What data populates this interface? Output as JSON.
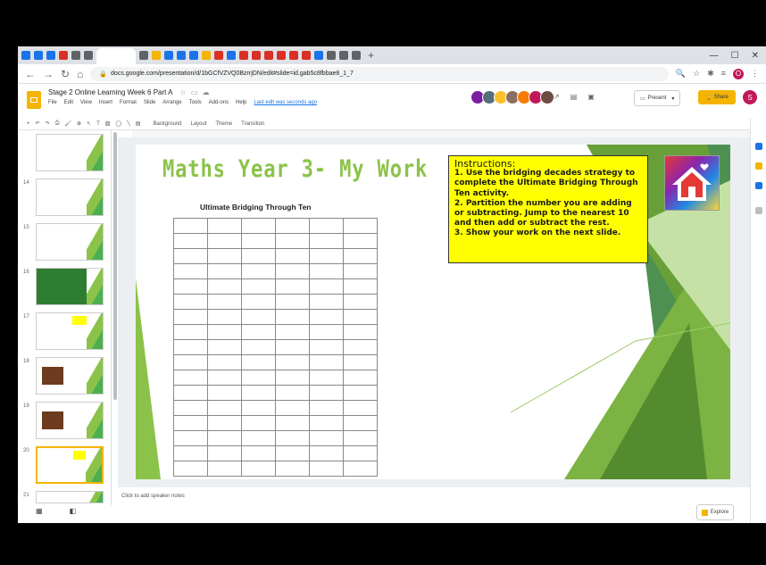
{
  "browser": {
    "url": "docs.google.com/presentation/d/1bGCfVZVQ0BzrrjDN/edit#slide=id.gab5c8fbbae8_1_7",
    "address_icons": [
      "search-icon",
      "star-icon",
      "extension-icon",
      "reading-list-icon",
      "profile-icon",
      "menu-icon"
    ],
    "profile_initial": "O",
    "tab_favicon_colors": [
      "#1a73e8",
      "#1a73e8",
      "#1a73e8",
      "#d93025",
      "#5f6368",
      "#5f6368",
      "#5f6368",
      "#f4b400",
      "#1a73e8",
      "#1a73e8",
      "#1a73e8",
      "#f4b400",
      "#d93025",
      "#1a73e8",
      "#d93025",
      "#d93025",
      "#d93025",
      "#d93025",
      "#d93025",
      "#d93025",
      "#1a73e8",
      "#5f6368",
      "#5f6368",
      "#5f6368"
    ]
  },
  "doc": {
    "title": "Stage 2 Online Learning Week 6 Part A",
    "menus": [
      "File",
      "Edit",
      "View",
      "Insert",
      "Format",
      "Slide",
      "Arrange",
      "Tools",
      "Add-ons",
      "Help"
    ],
    "last_edit": "Last edit was seconds ago",
    "present_label": "Present",
    "share_label": "Share",
    "user_initial": "S",
    "collaborator_colors": [
      "#7b1fa2",
      "#546e7a",
      "#fbc02d",
      "#8d6e63",
      "#f57c00",
      "#c2185b",
      "#6d4c41"
    ]
  },
  "toolbar": {
    "items": [
      "Background",
      "Layout",
      "Theme",
      "Transition"
    ]
  },
  "filmstrip": {
    "slide_numbers": [
      "",
      "14",
      "15",
      "16",
      "17",
      "18",
      "19",
      "20",
      "21"
    ],
    "selected_index": 7
  },
  "slide": {
    "title": "Maths Year 3- My Work",
    "sheet_title": "Ultimate Bridging Through Ten",
    "instructions": {
      "heading": "Instructions:",
      "lines": [
        "1.  Use the bridging decades strategy to complete the Ultimate Bridging Through Ten activity.",
        "2. Partition the number you are adding or subtracting. Jump to the nearest 10 and then add or subtract the rest.",
        "3. Show your work on the next slide."
      ]
    },
    "accent_color": "#8bc34a"
  },
  "notes": {
    "placeholder": "Click to add speaker notes"
  },
  "explore_label": "Explore"
}
